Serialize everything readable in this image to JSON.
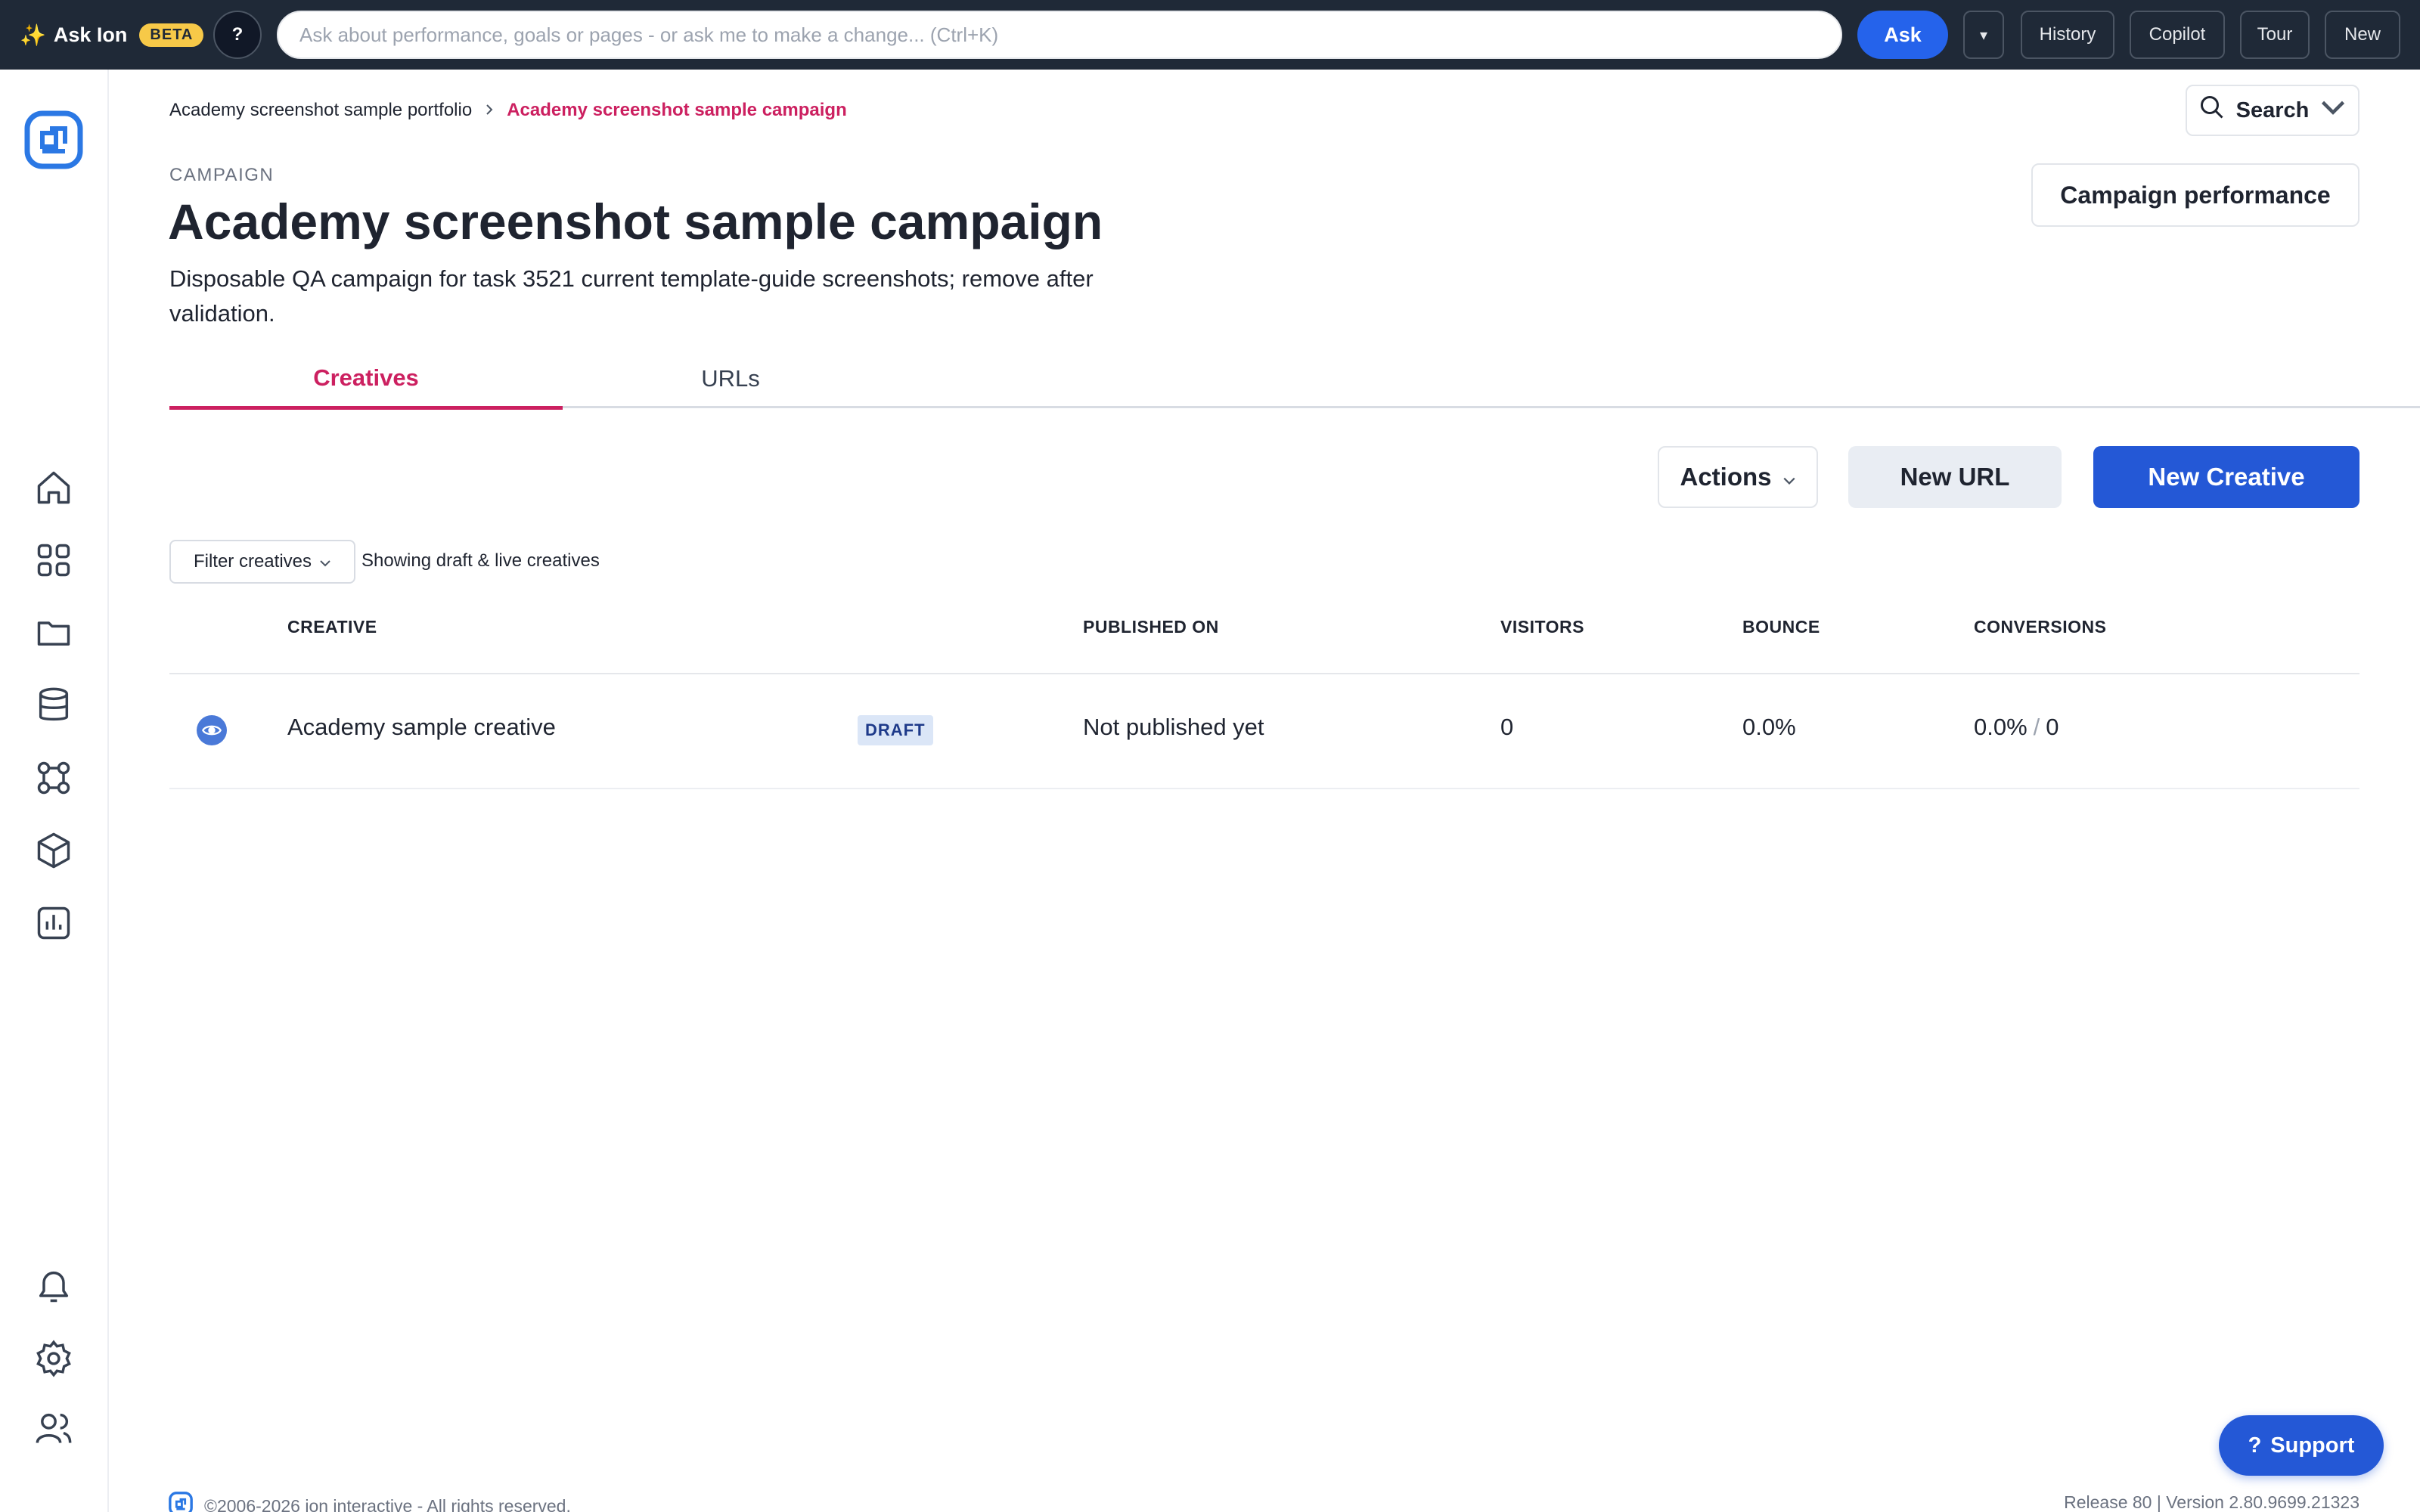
{
  "askbar": {
    "brand": "Ask Ion",
    "beta": "BETA",
    "help": "?",
    "placeholder": "Ask about performance, goals or pages - or ask me to make a change... (Ctrl+K)",
    "ask_label": "Ask",
    "dropdown_glyph": "▾",
    "history": "History",
    "copilot": "Copilot",
    "tour": "Tour",
    "new": "New"
  },
  "rail": {
    "logo": "ion-logo-icon",
    "items": [
      "home-icon",
      "apps-grid-icon",
      "folder-icon",
      "database-icon",
      "integrations-icon",
      "cube-icon",
      "analytics-icon"
    ],
    "bottom_items": [
      "bell-icon",
      "gear-icon",
      "users-icon"
    ]
  },
  "breadcrumb": {
    "parent": "Academy screenshot sample portfolio",
    "current": "Academy screenshot sample campaign"
  },
  "header": {
    "kicker": "CAMPAIGN",
    "title": "Academy screenshot sample campaign",
    "description": "Disposable QA campaign for task 3521 current template-guide screenshots; remove after validation.",
    "search_label": "Search",
    "campaign_performance_label": "Campaign performance"
  },
  "tabs": [
    {
      "label": "Creatives",
      "active": true
    },
    {
      "label": "URLs",
      "active": false
    }
  ],
  "toolbar": {
    "actions_label": "Actions",
    "new_url_label": "New URL",
    "new_creative_label": "New Creative"
  },
  "filter": {
    "label": "Filter creatives",
    "status": "Showing draft & live creatives"
  },
  "table": {
    "columns": [
      "CREATIVE",
      "PUBLISHED ON",
      "VISITORS",
      "BOUNCE",
      "CONVERSIONS"
    ],
    "rows": [
      {
        "name": "Academy sample creative",
        "status": "DRAFT",
        "published_on": "Not published yet",
        "visitors": "0",
        "bounce": "0.0%",
        "conversion_rate": "0.0%",
        "conversion_sep": "/",
        "conversions": "0"
      }
    ]
  },
  "footer": {
    "copyright": "©2006-2026 ion interactive - All rights reserved.",
    "version": "Release 80 | Version 2.80.9699.21323"
  },
  "support": {
    "glyph": "?",
    "label": "Support"
  },
  "colors": {
    "topbar": "#1f2937",
    "accent_pink": "#cc2060",
    "primary_blue": "#2458d6",
    "ask_blue": "#2563eb",
    "beta_yellow": "#f7c948"
  }
}
